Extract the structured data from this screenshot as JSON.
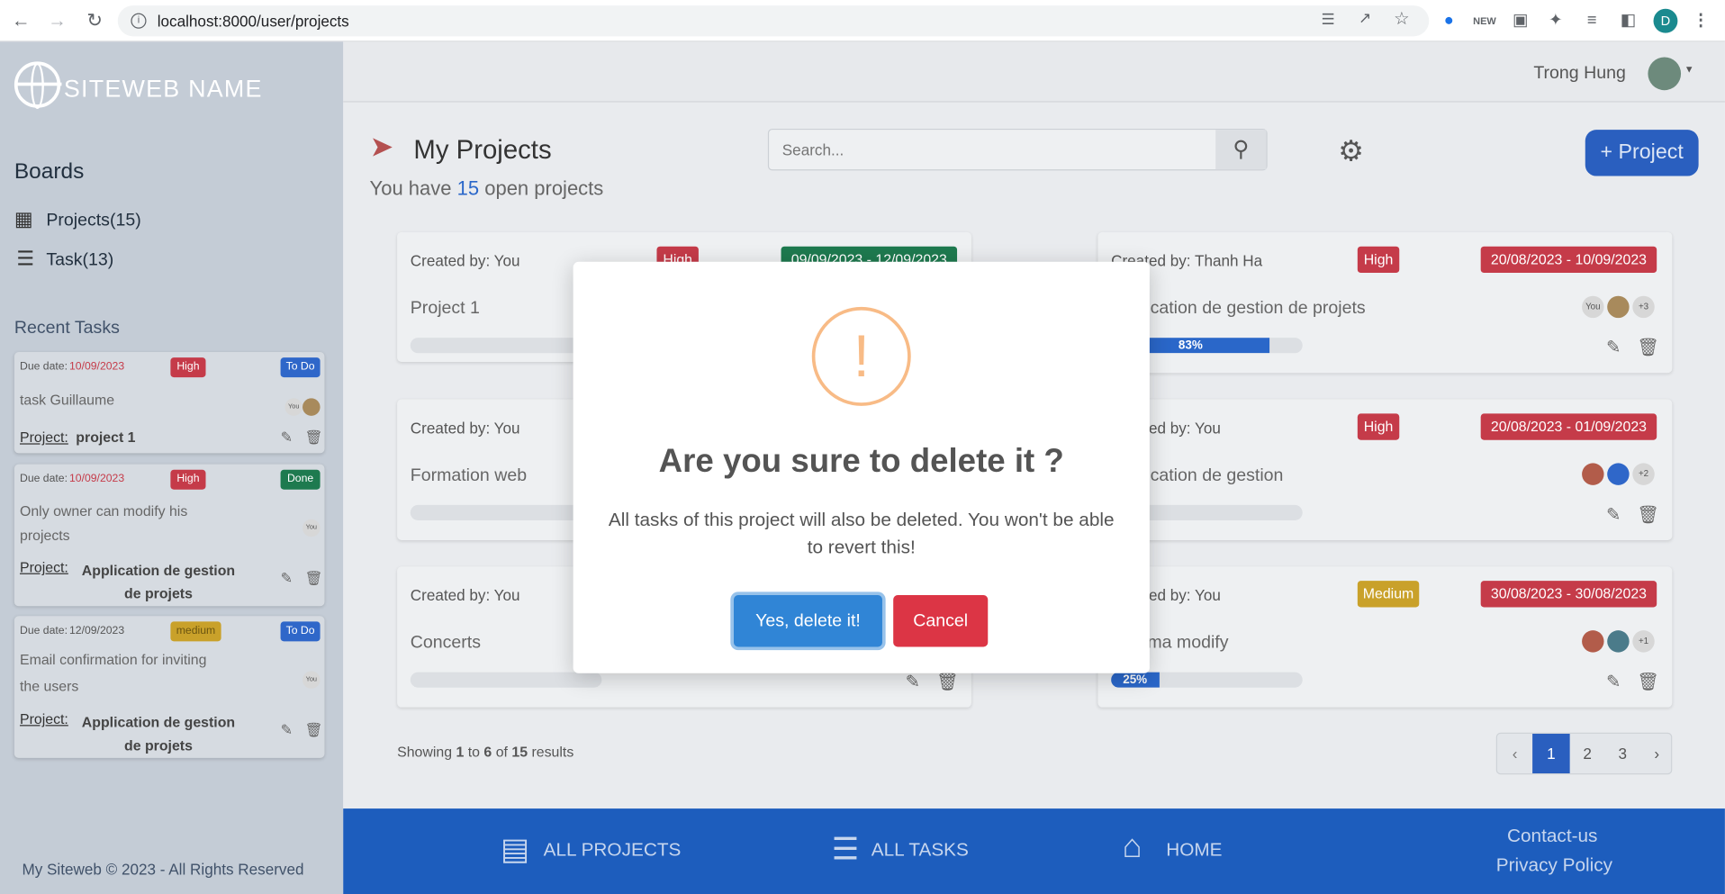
{
  "browser": {
    "url": "localhost:8000/user/projects",
    "profile_initial": "D"
  },
  "sidebar": {
    "logo_text": "SITEWEB NAME",
    "boards_title": "Boards",
    "items": [
      {
        "label": "Projects(15)"
      },
      {
        "label": "Task(13)"
      }
    ],
    "recent_title": "Recent Tasks",
    "tasks": [
      {
        "due_label": "Due date:",
        "due_date": "10/09/2023",
        "priority": "High",
        "status": "To Do",
        "title": "task Guillaume",
        "project_label": "Project:",
        "project": "project 1"
      },
      {
        "due_label": "Due date:",
        "due_date": "10/09/2023",
        "priority": "High",
        "status": "Done",
        "title": "Only owner can modify his projects",
        "project_label": "Project:",
        "project": "Application de gestion de projets"
      },
      {
        "due_label": "Due date:",
        "due_date": "12/09/2023",
        "priority": "medium",
        "status": "To Do",
        "title": "Email confirmation for inviting the users",
        "project_label": "Project:",
        "project": "Application de gestion de projets"
      }
    ],
    "copyright": "My Siteweb © 2023 - All Rights Reserved"
  },
  "topbar": {
    "user_name": "Trong Hung"
  },
  "main": {
    "title": "My Projects",
    "subtitle_prefix": "You have",
    "open_count": "15",
    "subtitle_suffix": "open projects",
    "search_placeholder": "Search...",
    "add_button": "+ Project",
    "projects": [
      {
        "created": "Created by: You",
        "priority": "High",
        "dates": "09/09/2023 - 12/09/2023",
        "title": "Project 1",
        "progress": 0
      },
      {
        "created": "Created by: Thanh Ha",
        "priority": "High",
        "dates": "20/08/2023 - 10/09/2023",
        "title": "Application de gestion de projets",
        "progress": 83,
        "progress_label": "83%"
      },
      {
        "created": "Created by: You",
        "priority": "",
        "dates": "",
        "title": "Formation web",
        "progress": 0
      },
      {
        "created": "Created by: You",
        "priority": "High",
        "dates": "20/08/2023 - 01/09/2023",
        "title": "Application de gestion",
        "progress": 0
      },
      {
        "created": "Created by: You",
        "priority": "",
        "dates": "",
        "title": "Concerts",
        "progress": 0
      },
      {
        "created": "Created by: You",
        "priority": "Medium",
        "dates": "30/08/2023 - 30/08/2023",
        "title": "Cinema modify",
        "progress": 25,
        "progress_label": "25%"
      }
    ],
    "showing": {
      "prefix": "Showing",
      "from": "1",
      "to_word": "to",
      "to": "6",
      "of_word": "of",
      "total": "15",
      "suffix": "results"
    },
    "pagination": [
      "‹",
      "1",
      "2",
      "3",
      "›"
    ],
    "avatars": {
      "you": "You",
      "plus3": "+3",
      "plus2": "+2",
      "plus1": "+1"
    }
  },
  "footer": {
    "all_projects": "ALL PROJECTS",
    "all_tasks": "ALL TASKS",
    "home": "HOME",
    "contact": "Contact-us",
    "privacy": "Privacy Policy"
  },
  "modal": {
    "title": "Are you sure to delete it ?",
    "text": "All tasks of this project will also be deleted. You won't be able to revert this!",
    "confirm": "Yes, delete it!",
    "cancel": "Cancel",
    "icon": "!"
  },
  "colors": {
    "primary": "#1d5dbd",
    "danger": "#dc3545",
    "confirm": "#3085d6",
    "warning_ring": "#f8bb86"
  }
}
